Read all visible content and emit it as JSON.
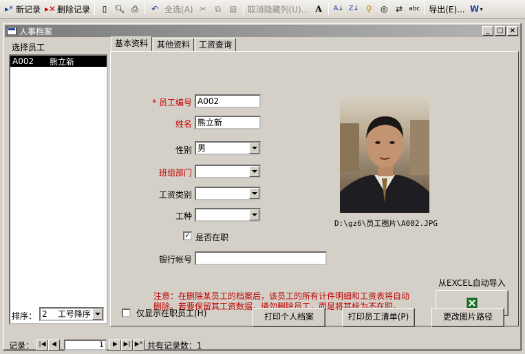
{
  "toolbar": {
    "new_record": "新记录",
    "delete_record": "删除记录",
    "select_all": "全选(A)",
    "unhide_columns": "取消隐藏列(U)...",
    "export": "导出(E)..."
  },
  "window": {
    "title": "人事档案"
  },
  "employee_list": {
    "label": "选择员工",
    "rows": [
      {
        "id": "A002",
        "name": "熊立新"
      }
    ]
  },
  "tabs": [
    {
      "label": "基本资料"
    },
    {
      "label": "其他资料"
    },
    {
      "label": "工资查询"
    }
  ],
  "form": {
    "emp_id_label": "* 员工编号",
    "emp_id_value": "A002",
    "name_label": "姓名",
    "name_value": "熊立新",
    "gender_label": "性别",
    "gender_value": "男",
    "dept_label": "班组部门",
    "dept_value": "",
    "salary_type_label": "工资类别",
    "salary_type_value": "",
    "job_label": "工种",
    "job_value": "",
    "employed_label": "是否在职",
    "employed_checked": "✓",
    "bank_label": "银行帐号",
    "bank_value": ""
  },
  "photo": {
    "path": "D:\\gz6\\员工图片\\A002.JPG"
  },
  "notice": {
    "text": "注意：在删除某员工的档案后，该员工的所有计件明细和工资表将自动删除。若要保留其工资数据，请勿删除员工，而是将其标为不在职。"
  },
  "excel": {
    "label": "从EXCEL自动导入"
  },
  "buttons": {
    "print_profile": "打印个人档案",
    "print_list": "打印员工清单(P)",
    "change_photo_path": "更改图片路径"
  },
  "sort": {
    "label": "排序：",
    "value": "2    工号降序"
  },
  "only_active": {
    "label": "仅显示在职员工(H)"
  },
  "nav": {
    "record_label": "记录：",
    "current": "1",
    "total_label": "共有记录数：1"
  },
  "colors": {
    "required_red": "#c00000",
    "excel_green": "#1f7a2e"
  }
}
